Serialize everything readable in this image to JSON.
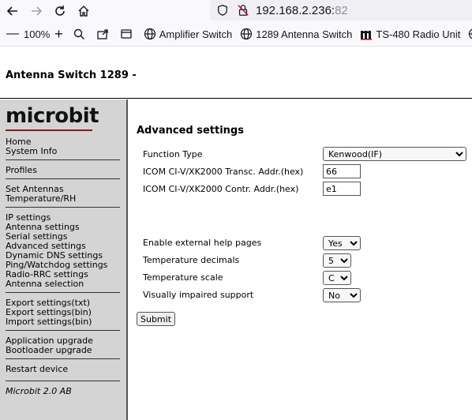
{
  "browser": {
    "url_host": "192.168.2.236:",
    "url_port": "82",
    "zoom": "100%",
    "bookmarks": [
      {
        "label": "Amplifier Switch",
        "icon": "globe-icon"
      },
      {
        "label": "1289 Antenna Switch",
        "icon": "globe-icon"
      },
      {
        "label": "TS-480 Radio Unit",
        "icon": "m-logo-icon"
      }
    ]
  },
  "page": {
    "title": "Antenna Switch 1289 -"
  },
  "sidebar": {
    "logo": "microbit",
    "groups": [
      [
        "Home",
        "System Info"
      ],
      [
        "Profiles"
      ],
      [
        "Set Antennas",
        "Temperature/RH"
      ],
      [
        "IP settings",
        "Antenna settings",
        "Serial settings",
        "Advanced settings",
        "Dynamic DNS settings",
        "Ping/Watchdog settings",
        "Radio-RRC settings",
        "Antenna selection"
      ],
      [
        "Export settings(txt)",
        "Export settings(bin)",
        "Import settings(bin)"
      ],
      [
        "Application upgrade",
        "Bootloader upgrade"
      ],
      [
        "Restart device"
      ]
    ],
    "footer": "Microbit 2.0 AB"
  },
  "form": {
    "heading": "Advanced settings",
    "function_type_label": "Function Type",
    "function_type_value": "Kenwood(IF)",
    "icom_transc_label": "ICOM CI-V/XK2000 Transc. Addr.(hex)",
    "icom_transc_value": "66",
    "icom_contr_label": "ICOM CI-V/XK2000 Contr. Addr.(hex)",
    "icom_contr_value": "e1",
    "help_pages_label": "Enable external help pages",
    "help_pages_value": "Yes",
    "temp_decimals_label": "Temperature decimals",
    "temp_decimals_value": "5",
    "temp_scale_label": "Temperature scale",
    "temp_scale_value": "C",
    "impaired_label": "Visually impaired support",
    "impaired_value": "No",
    "submit_label": "Submit"
  }
}
